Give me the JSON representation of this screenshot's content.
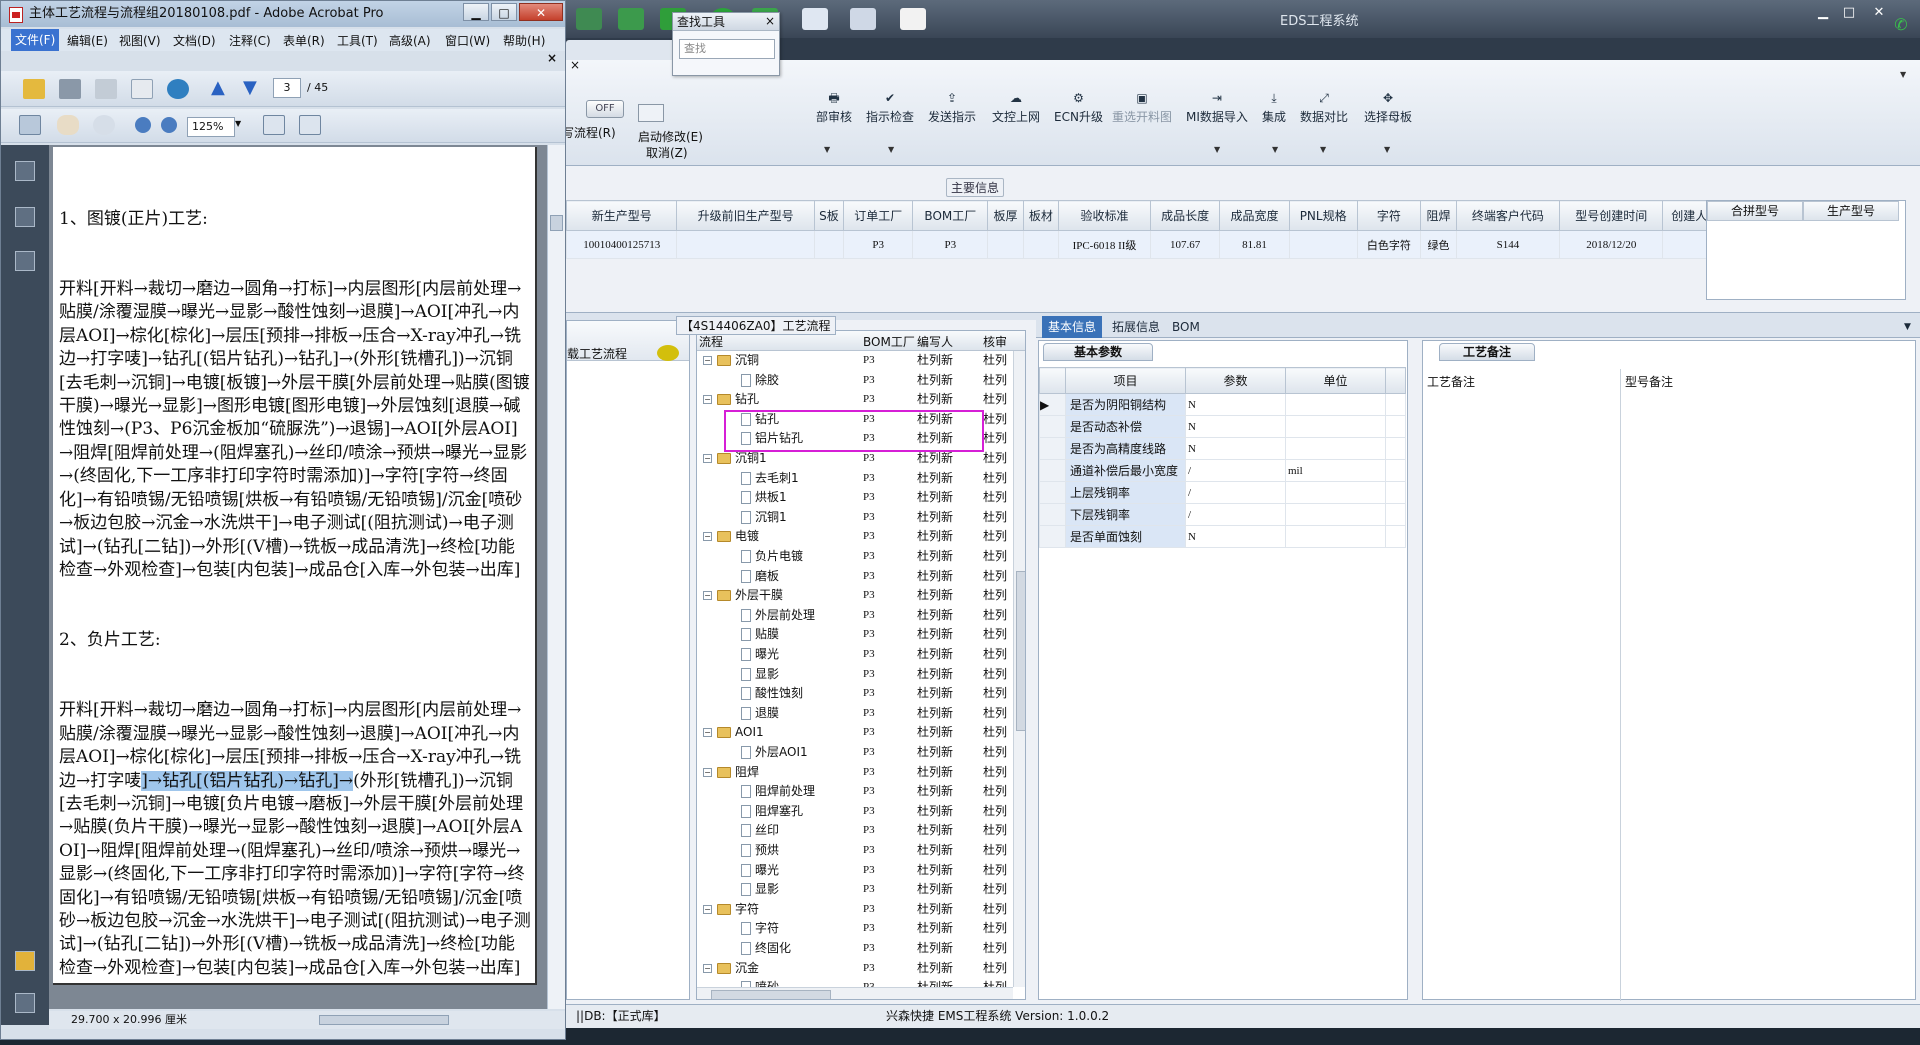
{
  "acrobat": {
    "window_title": "主体工艺流程与流程组20180108.pdf - Adobe Acrobat Pro",
    "minimize": "▁",
    "maximize": "□",
    "close": "✕",
    "menu": [
      "文件(F)",
      "编辑(E)",
      "视图(V)",
      "文档(D)",
      "注释(C)",
      "表单(R)",
      "工具(T)",
      "高级(A)",
      "窗口(W)",
      "帮助(H)"
    ],
    "close_doc": "×",
    "page_current": "3",
    "page_total": "/ 45",
    "zoom": "125%",
    "status_dimensions": "29.700 x 20.996 厘米",
    "doc_lines": [
      "1、图镀(正片)工艺:",
      "开料[开料→裁切→磨边→圆角→打标]→内层图形[内层前处理→贴膜/涂覆湿膜→曝光→显影→酸性蚀刻→退膜]→AOI[冲孔→内层AOI]→棕化[棕化]→层压[预排→排板→压合→X-ray冲孔→铣边→打字唛]→钻孔[(铝片钻孔)→钻孔]→(外形[铣槽孔])→沉铜[去毛刺→沉铜]→电镀[板镀]→外层干膜[外层前处理→贴膜(图镀干膜)→曝光→显影]→图形电镀[图形电镀]→外层蚀刻[退膜→碱性蚀刻→(P3、P6沉金板加“硫脲洗”)→退锡]→AOI[外层AOI]→阻焊[阻焊前处理→(阻焊塞孔)→丝印/喷涂→预烘→曝光→显影→(终固化,下一工序非打印字符时需添加)]→字符[字符→终固化]→有铅喷锡/无铅喷锡[烘板→有铅喷锡/无铅喷锡]/沉金[喷砂→板边包胶→沉金→水洗烘干]→电子测试[(阻抗测试)→电子测试]→(钻孔[二钻])→外形[(V槽)→铣板→成品清洗]→终检[功能检查→外观检查]→包装[内包装]→成品仓[入库→外包装→出库]",
      "2、负片工艺:",
      "开料[开料→裁切→磨边→圆角→打标]→内层图形[内层前处理→贴膜/涂覆湿膜→曝光→显影→酸性蚀刻→退膜]→AOI[冲孔→内层AOI]→棕化[棕化]→层压[预排→排板→压合→X-ray冲孔→铣边→打字唛",
      "]→钻孔[(铝片钻孔)→钻孔]→",
      "(外形[铣槽孔])→沉铜[去毛刺→沉铜]→电镀[负片电镀→磨板]→外层干膜[外层前处理→贴膜(负片干膜)→曝光→显影→酸性蚀刻→退膜]→AOI[外层AOI]→阻焊[阻焊前处理→(阻焊塞孔)→丝印/喷涂→预烘→曝光→显影→(终固化,下一工序非打印字符时需添加)]→字符[字符→终固化]→有铅喷锡/无铅喷锡[烘板→有铅喷锡/无铅喷锡]/沉金[喷砂→板边包胶→沉金→水洗烘干]→电子测试[(阻抗测试)→电子测试]→(钻孔[二钻])→外形[(V槽)→铣板→成品清洗]→终检[功能检查→外观检查]→包装[内包装]→成品仓[入库→外包装→出库]"
    ]
  },
  "eds": {
    "window_title": "EDS工程系统",
    "off_label": "OFF",
    "find_tool": {
      "title": "查找工具",
      "placeholder": "查找",
      "close": "×"
    },
    "left_ribbon_labels": [
      "写流程(R)",
      "启动修改(E)",
      "取消(Z)"
    ],
    "ribbon_buttons": [
      {
        "label": "部审核",
        "icon": "🖶"
      },
      {
        "label": "指示检查",
        "icon": "✔"
      },
      {
        "label": "发送指示",
        "icon": "⇪"
      },
      {
        "label": "文控上网",
        "icon": "☁"
      },
      {
        "label": "ECN升级",
        "icon": "⚙"
      },
      {
        "label": "重选开料图",
        "icon": "▣"
      },
      {
        "label": "MI数据导入",
        "icon": "⇥"
      },
      {
        "label": "集成",
        "icon": "⤓"
      },
      {
        "label": "数据对比",
        "icon": "⤢"
      },
      {
        "label": "选择母板",
        "icon": "✥"
      }
    ],
    "main_info_title": "主要信息",
    "product_columns": [
      "新生产型号",
      "升级前旧生产型号",
      "S板",
      "订单工厂",
      "BOM工厂",
      "板厚",
      "板材",
      "验收标准",
      "成品长度",
      "成品宽度",
      "PNL规格",
      "字符",
      "阻焊",
      "终端客户代码",
      "型号创建时间",
      "创建人"
    ],
    "product_row": [
      "10010400125713",
      "",
      "",
      "P3",
      "P3",
      "",
      "",
      "IPC-6018 II级",
      "107.67",
      "81.81",
      "",
      "白色字符",
      "绿色",
      "S144",
      "2018/12/20",
      ""
    ],
    "right_columns": [
      "合拼型号",
      "生产型号"
    ],
    "proc_panel_label": "载工艺流程",
    "flow_title": "【4S14406ZA0】工艺流程",
    "flow_columns": [
      "流程",
      "BOM工厂",
      "编写人",
      "核审"
    ],
    "flow_rows": [
      {
        "level": 1,
        "type": "folder",
        "name": "沉铜",
        "bom": "P3",
        "writer": "杜列新",
        "reviewer": "杜列"
      },
      {
        "level": 2,
        "type": "doc",
        "name": "除胶",
        "bom": "P3",
        "writer": "杜列新",
        "reviewer": "杜列"
      },
      {
        "level": 1,
        "type": "folder",
        "name": "钻孔",
        "bom": "P3",
        "writer": "杜列新",
        "reviewer": "杜列"
      },
      {
        "level": 2,
        "type": "doc",
        "name": "钻孔",
        "bom": "P3",
        "writer": "杜列新",
        "reviewer": "杜列"
      },
      {
        "level": 2,
        "type": "doc",
        "name": "铝片钻孔",
        "bom": "P3",
        "writer": "杜列新",
        "reviewer": "杜列"
      },
      {
        "level": 1,
        "type": "folder",
        "name": "沉铜1",
        "bom": "P3",
        "writer": "杜列新",
        "reviewer": "杜列"
      },
      {
        "level": 2,
        "type": "doc",
        "name": "去毛刺1",
        "bom": "P3",
        "writer": "杜列新",
        "reviewer": "杜列"
      },
      {
        "level": 2,
        "type": "doc",
        "name": "烘板1",
        "bom": "P3",
        "writer": "杜列新",
        "reviewer": "杜列"
      },
      {
        "level": 2,
        "type": "doc",
        "name": "沉铜1",
        "bom": "P3",
        "writer": "杜列新",
        "reviewer": "杜列"
      },
      {
        "level": 1,
        "type": "folder",
        "name": "电镀",
        "bom": "P3",
        "writer": "杜列新",
        "reviewer": "杜列"
      },
      {
        "level": 2,
        "type": "doc",
        "name": "负片电镀",
        "bom": "P3",
        "writer": "杜列新",
        "reviewer": "杜列"
      },
      {
        "level": 2,
        "type": "doc",
        "name": "磨板",
        "bom": "P3",
        "writer": "杜列新",
        "reviewer": "杜列"
      },
      {
        "level": 1,
        "type": "folder",
        "name": "外层干膜",
        "bom": "P3",
        "writer": "杜列新",
        "reviewer": "杜列"
      },
      {
        "level": 2,
        "type": "doc",
        "name": "外层前处理",
        "bom": "P3",
        "writer": "杜列新",
        "reviewer": "杜列"
      },
      {
        "level": 2,
        "type": "doc",
        "name": "贴膜",
        "bom": "P3",
        "writer": "杜列新",
        "reviewer": "杜列"
      },
      {
        "level": 2,
        "type": "doc",
        "name": "曝光",
        "bom": "P3",
        "writer": "杜列新",
        "reviewer": "杜列"
      },
      {
        "level": 2,
        "type": "doc",
        "name": "显影",
        "bom": "P3",
        "writer": "杜列新",
        "reviewer": "杜列"
      },
      {
        "level": 2,
        "type": "doc",
        "name": "酸性蚀刻",
        "bom": "P3",
        "writer": "杜列新",
        "reviewer": "杜列"
      },
      {
        "level": 2,
        "type": "doc",
        "name": "退膜",
        "bom": "P3",
        "writer": "杜列新",
        "reviewer": "杜列"
      },
      {
        "level": 1,
        "type": "folder",
        "name": "AOI1",
        "bom": "P3",
        "writer": "杜列新",
        "reviewer": "杜列"
      },
      {
        "level": 2,
        "type": "doc",
        "name": "外层AOI1",
        "bom": "P3",
        "writer": "杜列新",
        "reviewer": "杜列"
      },
      {
        "level": 1,
        "type": "folder",
        "name": "阻焊",
        "bom": "P3",
        "writer": "杜列新",
        "reviewer": "杜列"
      },
      {
        "level": 2,
        "type": "doc",
        "name": "阻焊前处理",
        "bom": "P3",
        "writer": "杜列新",
        "reviewer": "杜列"
      },
      {
        "level": 2,
        "type": "doc",
        "name": "阻焊塞孔",
        "bom": "P3",
        "writer": "杜列新",
        "reviewer": "杜列"
      },
      {
        "level": 2,
        "type": "doc",
        "name": "丝印",
        "bom": "P3",
        "writer": "杜列新",
        "reviewer": "杜列"
      },
      {
        "level": 2,
        "type": "doc",
        "name": "预烘",
        "bom": "P3",
        "writer": "杜列新",
        "reviewer": "杜列"
      },
      {
        "level": 2,
        "type": "doc",
        "name": "曝光",
        "bom": "P3",
        "writer": "杜列新",
        "reviewer": "杜列"
      },
      {
        "level": 2,
        "type": "doc",
        "name": "显影",
        "bom": "P3",
        "writer": "杜列新",
        "reviewer": "杜列"
      },
      {
        "level": 1,
        "type": "folder",
        "name": "字符",
        "bom": "P3",
        "writer": "杜列新",
        "reviewer": "杜列"
      },
      {
        "level": 2,
        "type": "doc",
        "name": "字符",
        "bom": "P3",
        "writer": "杜列新",
        "reviewer": "杜列"
      },
      {
        "level": 2,
        "type": "doc",
        "name": "终固化",
        "bom": "P3",
        "writer": "杜列新",
        "reviewer": "杜列"
      },
      {
        "level": 1,
        "type": "folder",
        "name": "沉金",
        "bom": "P3",
        "writer": "杜列新",
        "reviewer": "杜列"
      },
      {
        "level": 2,
        "type": "doc",
        "name": "喷砂",
        "bom": "P3",
        "writer": "杜列新",
        "reviewer": "杜列"
      }
    ],
    "info_tabs": [
      "基本信息",
      "拓展信息",
      "BOM"
    ],
    "basic_params_title": "基本参数",
    "param_columns": [
      "项目",
      "参数",
      "单位"
    ],
    "params": [
      {
        "item": "是否为阴阳铜结构",
        "value": "N",
        "unit": ""
      },
      {
        "item": "是否动态补偿",
        "value": "N",
        "unit": ""
      },
      {
        "item": "是否为高精度线路",
        "value": "N",
        "unit": ""
      },
      {
        "item": "通道补偿后最小宽度",
        "value": "/",
        "unit": "mil"
      },
      {
        "item": "上层残铜率",
        "value": "/",
        "unit": ""
      },
      {
        "item": "下层残铜率",
        "value": "/",
        "unit": ""
      },
      {
        "item": "是否单面蚀刻",
        "value": "N",
        "unit": ""
      }
    ],
    "remark_title": "工艺备注",
    "remark_columns": [
      "工艺备注",
      "型号备注"
    ],
    "status_db": "||DB:【正式库】",
    "status_version": "兴森快捷 EMS工程系统 Version: 1.0.0.2"
  }
}
